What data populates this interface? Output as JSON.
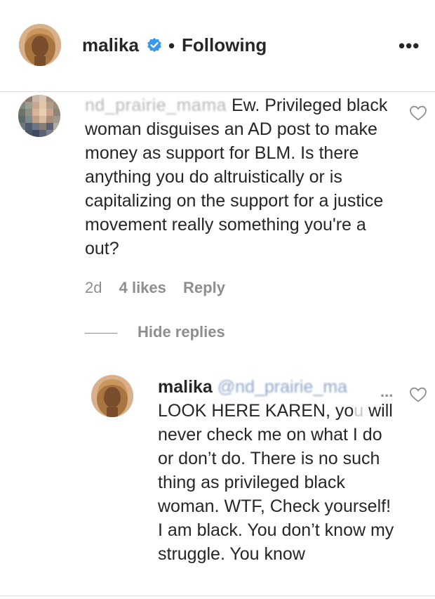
{
  "header": {
    "username": "malika",
    "separator": "•",
    "follow_status": "Following",
    "more_label": "•••",
    "icons": {
      "verified": "verified-badge-icon",
      "more": "more-options-icon"
    }
  },
  "comment": {
    "username_blurred": "nd_prairie_mama",
    "text": "Ew. Privileged black woman disguises an AD post to make money as support for BLM. Is there anything you do altruistically or is capitalizing on the support for a justice movement really something you're a out?",
    "age": "2d",
    "likes": "4 likes",
    "reply_label": "Reply",
    "hide_replies_label": "Hide replies"
  },
  "reply": {
    "username": "malika",
    "mention_blurred": "@nd_prairie_ma",
    "ellipsis": "...",
    "text_before": "LOOK HERE KAREN, yo",
    "text_faded": "u",
    "text_after": " will never check me on what I do or don’t do. There is no such thing as privileged black woman. WTF, Check yourself! I am black. You don’t know my struggle. You know"
  },
  "colors": {
    "text": "#262626",
    "muted": "#8e8e8e",
    "verified": "#3897f0",
    "divider": "#dbdbdb"
  }
}
